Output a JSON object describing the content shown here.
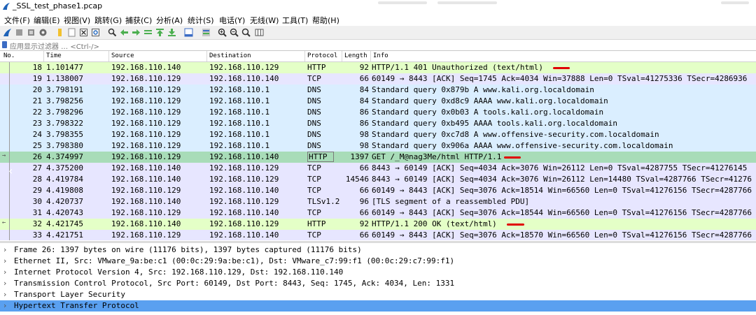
{
  "window": {
    "title": "_SSL_test_phase1.pcap"
  },
  "menu": [
    "文件(F)",
    "编辑(E)",
    "视图(V)",
    "跳转(G)",
    "捕获(C)",
    "分析(A)",
    "统计(S)",
    "电话(Y)",
    "无线(W)",
    "工具(T)",
    "帮助(H)"
  ],
  "toolbar_icons": [
    "shark-fin-start-icon",
    "stop-icon",
    "restart-icon",
    "options-gear-icon",
    "open-folder-icon",
    "file-icon",
    "close-file-icon",
    "reload-icon",
    "find-icon",
    "back-arrow-icon",
    "forward-arrow-icon",
    "goto-packet-icon",
    "first-packet-icon",
    "last-packet-icon",
    "autoscroll-icon",
    "colorize-icon",
    "zoom-in-icon",
    "zoom-out-icon",
    "zoom-normal-icon",
    "resize-columns-icon"
  ],
  "filter": {
    "placeholder": "应用显示过滤器 … <Ctrl-/>"
  },
  "columns": {
    "no": "No.",
    "time": "Time",
    "source": "Source",
    "destination": "Destination",
    "protocol": "Protocol",
    "length": "Length",
    "info": "Info"
  },
  "packets": [
    {
      "no": "18",
      "time": "1.101477",
      "source": "192.168.110.140",
      "destination": "192.168.110.129",
      "protocol": "HTTP",
      "length": "92",
      "info": "HTTP/1.1 401 Unauthorized  (text/html)",
      "bg": "#e4ffc7"
    },
    {
      "no": "19",
      "time": "1.138007",
      "source": "192.168.110.129",
      "destination": "192.168.110.140",
      "protocol": "TCP",
      "length": "66",
      "info": "60149 → 8443 [ACK] Seq=1745 Ack=4034 Win=37888 Len=0 TSval=41275336 TSecr=4286936",
      "bg": "#e7e6ff"
    },
    {
      "no": "20",
      "time": "3.798191",
      "source": "192.168.110.129",
      "destination": "192.168.110.1",
      "protocol": "DNS",
      "length": "84",
      "info": "Standard query 0x879b A www.kali.org.localdomain",
      "bg": "#daeeff"
    },
    {
      "no": "21",
      "time": "3.798256",
      "source": "192.168.110.129",
      "destination": "192.168.110.1",
      "protocol": "DNS",
      "length": "84",
      "info": "Standard query 0xd8c9 AAAA www.kali.org.localdomain",
      "bg": "#daeeff"
    },
    {
      "no": "22",
      "time": "3.798296",
      "source": "192.168.110.129",
      "destination": "192.168.110.1",
      "protocol": "DNS",
      "length": "86",
      "info": "Standard query 0x0b03 A tools.kali.org.localdomain",
      "bg": "#daeeff"
    },
    {
      "no": "23",
      "time": "3.798322",
      "source": "192.168.110.129",
      "destination": "192.168.110.1",
      "protocol": "DNS",
      "length": "86",
      "info": "Standard query 0xb495 AAAA tools.kali.org.localdomain",
      "bg": "#daeeff"
    },
    {
      "no": "24",
      "time": "3.798355",
      "source": "192.168.110.129",
      "destination": "192.168.110.1",
      "protocol": "DNS",
      "length": "98",
      "info": "Standard query 0xc7d8 A www.offensive-security.com.localdomain",
      "bg": "#daeeff"
    },
    {
      "no": "25",
      "time": "3.798380",
      "source": "192.168.110.129",
      "destination": "192.168.110.1",
      "protocol": "DNS",
      "length": "98",
      "info": "Standard query 0x906a AAAA www.offensive-security.com.localdomain",
      "bg": "#daeeff"
    },
    {
      "no": "26",
      "time": "4.374997",
      "source": "192.168.110.129",
      "destination": "192.168.110.140",
      "protocol": "HTTP",
      "length": "1397",
      "info": "GET /_M@nag3Me/html HTTP/1.1",
      "bg": "#a8dcb8"
    },
    {
      "no": "27",
      "time": "4.375200",
      "source": "192.168.110.140",
      "destination": "192.168.110.129",
      "protocol": "TCP",
      "length": "66",
      "info": "8443 → 60149 [ACK] Seq=4034 Ack=3076 Win=26112 Len=0 TSval=4287755 TSecr=41276145",
      "bg": "#e7e6ff"
    },
    {
      "no": "28",
      "time": "4.419784",
      "source": "192.168.110.140",
      "destination": "192.168.110.129",
      "protocol": "TCP",
      "length": "14546",
      "info": "8443 → 60149 [ACK] Seq=4034 Ack=3076 Win=26112 Len=14480 TSval=4287766 TSecr=41276",
      "bg": "#e7e6ff"
    },
    {
      "no": "29",
      "time": "4.419808",
      "source": "192.168.110.129",
      "destination": "192.168.110.140",
      "protocol": "TCP",
      "length": "66",
      "info": "60149 → 8443 [ACK] Seq=3076 Ack=18514 Win=66560 Len=0 TSval=41276156 TSecr=4287766",
      "bg": "#e7e6ff"
    },
    {
      "no": "30",
      "time": "4.420737",
      "source": "192.168.110.140",
      "destination": "192.168.110.129",
      "protocol": "TLSv1.2",
      "length": "96",
      "info": "[TLS segment of a reassembled PDU]",
      "bg": "#e7e6ff"
    },
    {
      "no": "31",
      "time": "4.420743",
      "source": "192.168.110.129",
      "destination": "192.168.110.140",
      "protocol": "TCP",
      "length": "66",
      "info": "60149 → 8443 [ACK] Seq=3076 Ack=18544 Win=66560 Len=0 TSval=41276156 TSecr=4287766",
      "bg": "#e7e6ff"
    },
    {
      "no": "32",
      "time": "4.421745",
      "source": "192.168.110.140",
      "destination": "192.168.110.129",
      "protocol": "HTTP",
      "length": "92",
      "info": "HTTP/1.1 200 OK  (text/html)",
      "bg": "#e4ffc7"
    },
    {
      "no": "33",
      "time": "4.421751",
      "source": "192.168.110.129",
      "destination": "192.168.110.140",
      "protocol": "TCP",
      "length": "66",
      "info": "60149 → 8443 [ACK] Seq=3076 Ack=18570 Win=66560 Len=0 TSval=41276156 TSecr=4287766",
      "bg": "#e7e6ff"
    }
  ],
  "details": [
    "Frame 26: 1397 bytes on wire (11176 bits), 1397 bytes captured (11176 bits)",
    "Ethernet II, Src: VMware_9a:be:c1 (00:0c:29:9a:be:c1), Dst: VMware_c7:99:f1 (00:0c:29:c7:99:f1)",
    "Internet Protocol Version 4, Src: 192.168.110.129, Dst: 192.168.110.140",
    "Transmission Control Protocol, Src Port: 60149, Dst Port: 8443, Seq: 1745, Ack: 4034, Len: 1331",
    "Transport Layer Security",
    "Hypertext Transfer Protocol"
  ],
  "colors": {
    "selected_row": "#a8dcb8",
    "selected_detail": "#5aa0f0",
    "annotation_mark": "#e00000"
  }
}
